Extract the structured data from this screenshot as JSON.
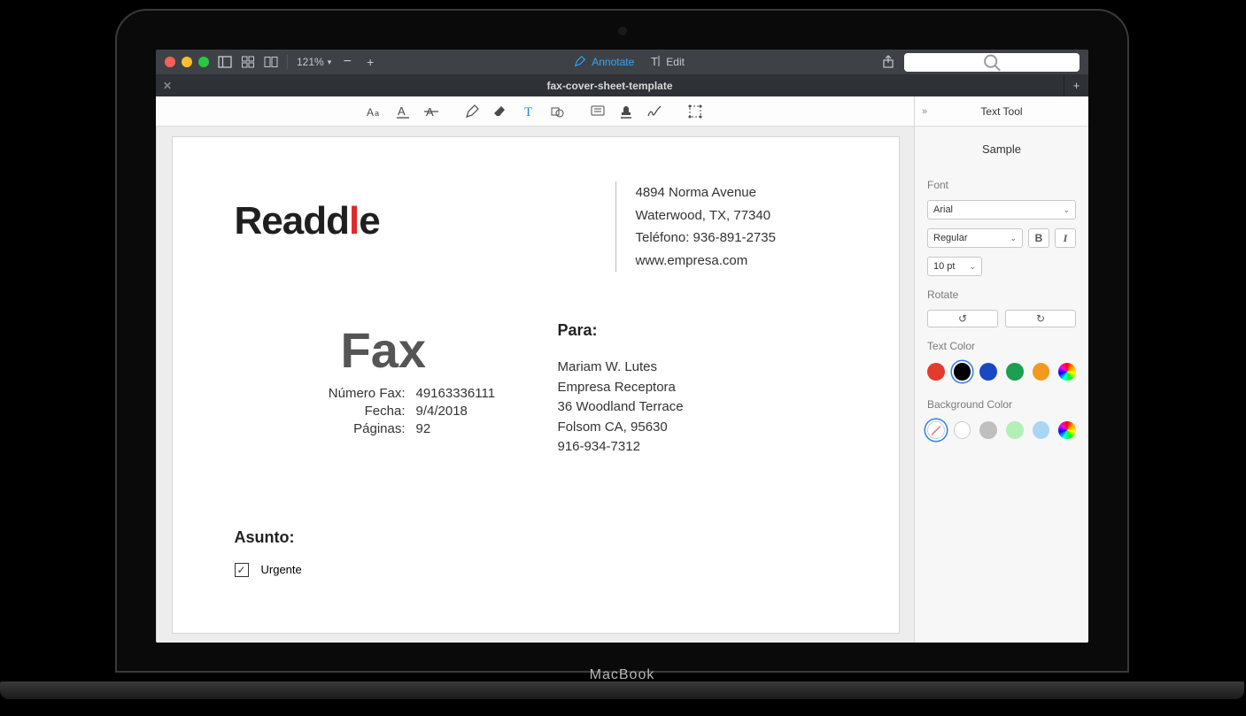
{
  "toolbar": {
    "zoom": "121%",
    "annotate": "Annotate",
    "edit": "Edit",
    "search_placeholder": ""
  },
  "tab": {
    "title": "fax-cover-sheet-template"
  },
  "sidebar": {
    "title": "Text Tool",
    "sample": "Sample",
    "font_label": "Font",
    "font_family": "Arial",
    "font_weight": "Regular",
    "bold": "B",
    "italic": "I",
    "font_size": "10 pt",
    "rotate_label": "Rotate",
    "text_color_label": "Text Color",
    "bg_color_label": "Background Color",
    "text_colors": [
      "#e33b2e",
      "#000000",
      "#1948c4",
      "#1aa050",
      "#f19a1f",
      "rainbow"
    ],
    "text_color_selected": 1,
    "bg_colors": [
      "none",
      "#ffffff",
      "#bfbfbf",
      "#b3f0b8",
      "#a9d6f5",
      "rainbow"
    ],
    "bg_color_selected": 0
  },
  "document": {
    "logo_left": "Readd",
    "logo_right": "e",
    "header_lines": [
      "4894 Norma Avenue",
      "Waterwood, TX, 77340",
      "Teléfono: 936-891-2735",
      "www.empresa.com"
    ],
    "fax_title": "Fax",
    "fields": {
      "numero_fax_label": "Número Fax:",
      "numero_fax_value": "49163336111",
      "fecha_label": "Fecha:",
      "fecha_value": "9/4/2018",
      "paginas_label": "Páginas:",
      "paginas_value": "92"
    },
    "para_label": "Para:",
    "para_lines": [
      "Mariam W. Lutes",
      "Empresa Receptora",
      "36 Woodland Terrace",
      "Folsom CA, 95630",
      "916-934-7312"
    ],
    "asunto_label": "Asunto:",
    "urgente_label": "Urgente",
    "urgente_checked": true
  }
}
